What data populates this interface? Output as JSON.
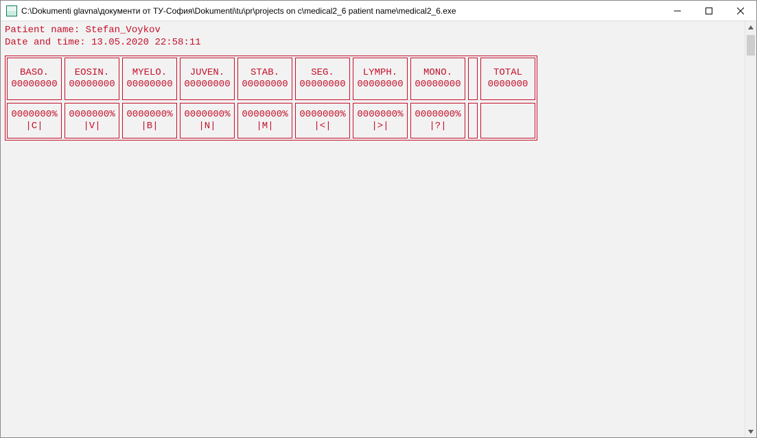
{
  "window": {
    "title": "C:\\Dokumenti glavna\\документи от ТУ-София\\Dokumenti\\tu\\pr\\projects on c\\medical2_6 patient name\\medical2_6.exe"
  },
  "header": {
    "patient_label": "Patient name: ",
    "patient_name": "Stefan_Voykov",
    "datetime_label": "Date and time: ",
    "datetime_value": "13.05.2020 22:58:11"
  },
  "columns": [
    {
      "label": "BASO.",
      "count": "00000000",
      "pct": "0000000%",
      "key": "|C|"
    },
    {
      "label": "EOSIN.",
      "count": "00000000",
      "pct": "0000000%",
      "key": "|V|"
    },
    {
      "label": "MYELO.",
      "count": "00000000",
      "pct": "0000000%",
      "key": "|B|"
    },
    {
      "label": "JUVEN.",
      "count": "00000000",
      "pct": "0000000%",
      "key": "|N|"
    },
    {
      "label": "STAB.",
      "count": "00000000",
      "pct": "0000000%",
      "key": "|M|"
    },
    {
      "label": "SEG.",
      "count": "00000000",
      "pct": "0000000%",
      "key": "|<|"
    },
    {
      "label": "LYMPH.",
      "count": "00000000",
      "pct": "0000000%",
      "key": "|>|"
    },
    {
      "label": "MONO.",
      "count": "00000000",
      "pct": "0000000%",
      "key": "|?|"
    }
  ],
  "total": {
    "label": "TOTAL",
    "count": "0000000"
  }
}
